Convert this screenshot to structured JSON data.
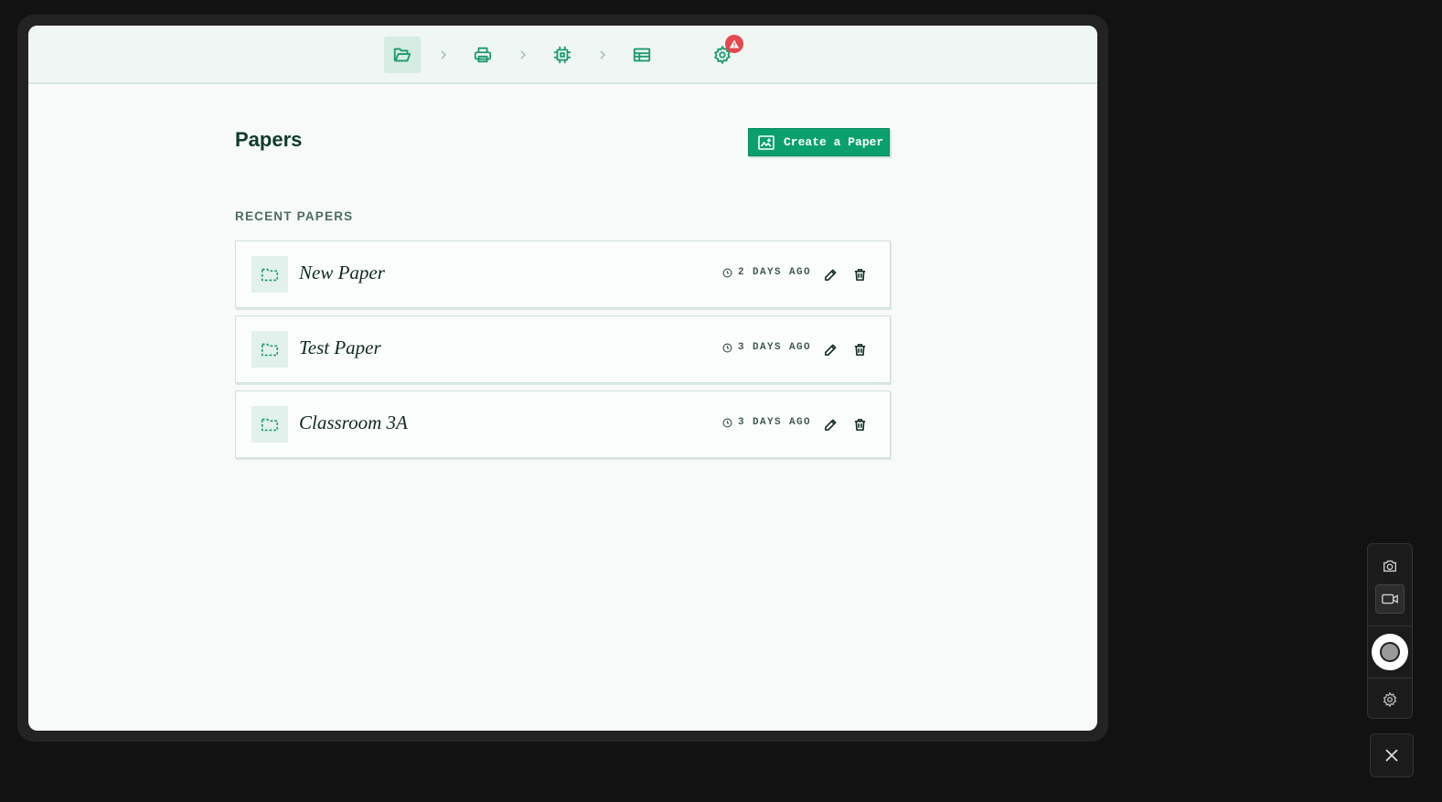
{
  "workflow_steps": [
    {
      "id": "files",
      "icon": "folder-open-icon",
      "active": true
    },
    {
      "id": "print",
      "icon": "printer-icon",
      "active": false
    },
    {
      "id": "process",
      "icon": "cpu-chip-icon",
      "active": false
    },
    {
      "id": "table",
      "icon": "table-icon",
      "active": false
    }
  ],
  "settings_alert": true,
  "page": {
    "title": "Papers",
    "create_button_label": "Create a Paper",
    "section_label": "RECENT PAPERS"
  },
  "papers": [
    {
      "name": "New Paper",
      "time": "2 DAYS AGO"
    },
    {
      "name": "Test Paper",
      "time": "3 DAYS AGO"
    },
    {
      "name": "Classroom 3A",
      "time": "3 DAYS AGO"
    }
  ],
  "recorder_panel": {
    "buttons": [
      "camera-icon",
      "video-icon",
      "record-icon",
      "gear-icon"
    ],
    "active": "video-icon"
  },
  "colors": {
    "accent": "#0aa06e",
    "icon_green": "#1a9a6c",
    "title": "#0d3b2c",
    "alert": "#e5484d"
  }
}
